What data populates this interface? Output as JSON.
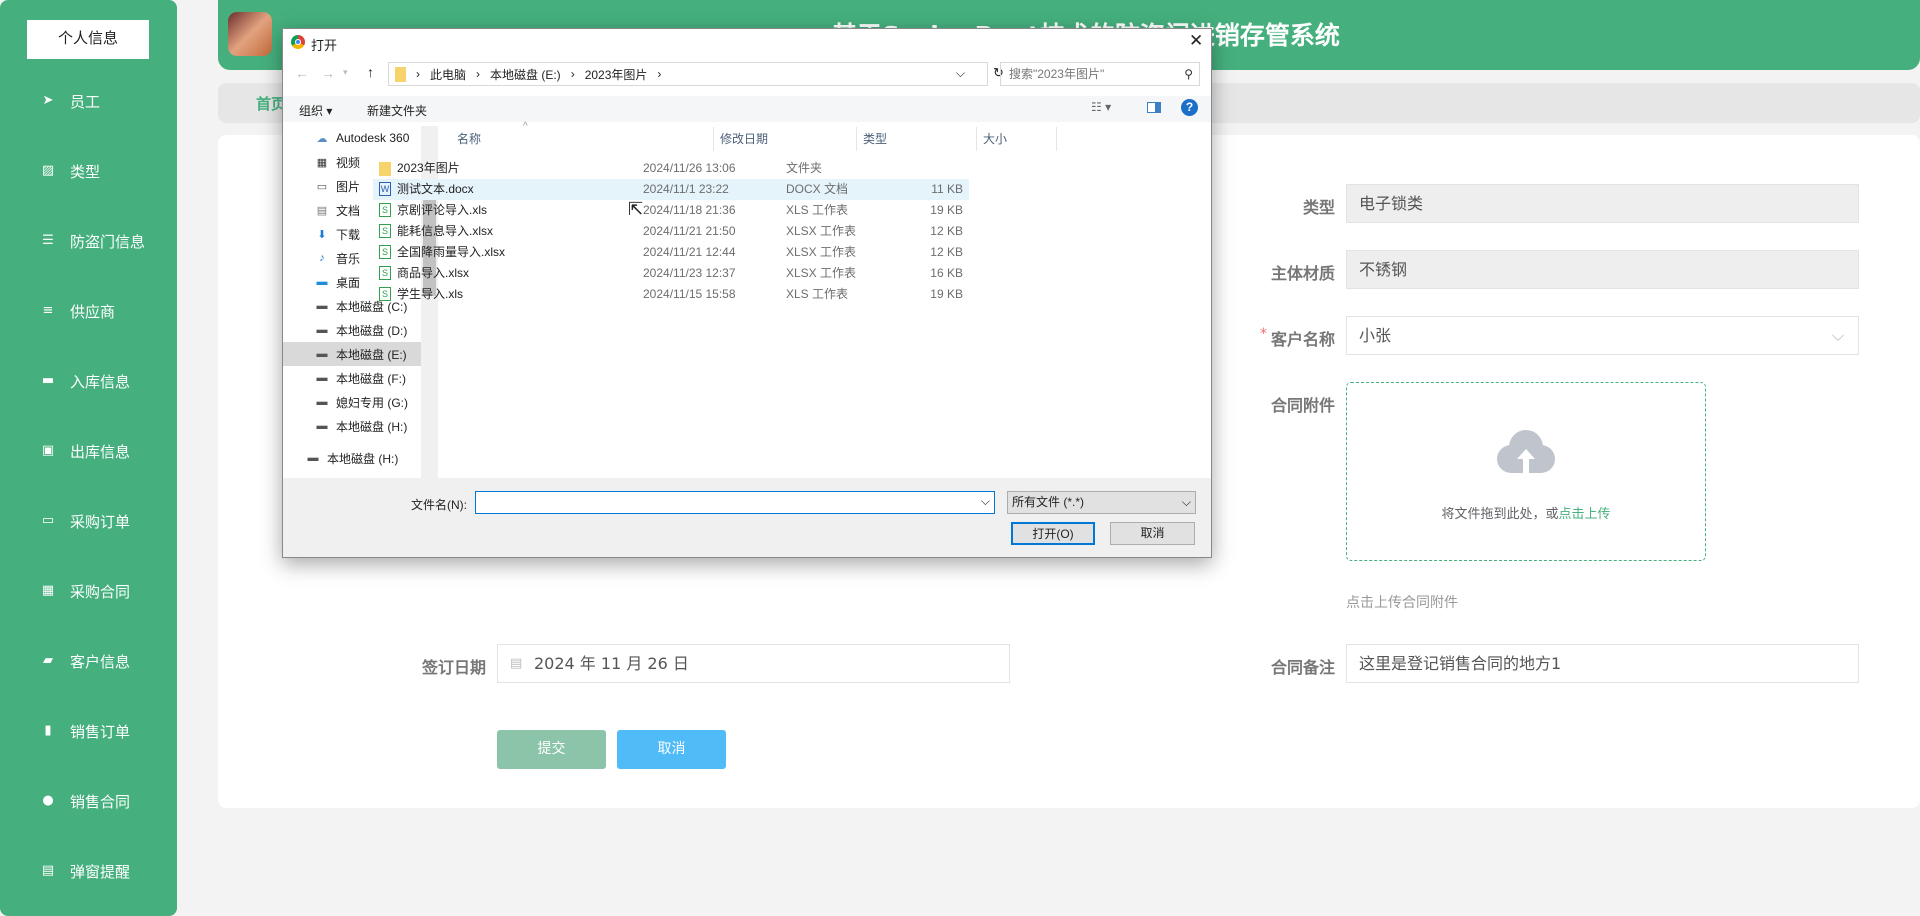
{
  "sidebar": {
    "profile": "个人信息",
    "items": [
      {
        "label": "员工",
        "icon": "paper-plane-icon"
      },
      {
        "label": "类型",
        "icon": "chart-icon"
      },
      {
        "label": "防盗门信息",
        "icon": "sliders-icon"
      },
      {
        "label": "供应商",
        "icon": "list-icon"
      },
      {
        "label": "入库信息",
        "icon": "briefcase-icon"
      },
      {
        "label": "出库信息",
        "icon": "clipboard-x-icon"
      },
      {
        "label": "采购订单",
        "icon": "chat-icon"
      },
      {
        "label": "采购合同",
        "icon": "grid-icon"
      },
      {
        "label": "客户信息",
        "icon": "wallet-icon"
      },
      {
        "label": "销售订单",
        "icon": "bar-chart-icon"
      },
      {
        "label": "销售合同",
        "icon": "bulb-icon"
      },
      {
        "label": "弹窗提醒",
        "icon": "clipboard-icon"
      }
    ]
  },
  "header": {
    "title": "基于SpringBoot技术的防盗门进销存管系统"
  },
  "breadcrumb": {
    "home": "首页"
  },
  "form": {
    "type_label": "类型",
    "type_value": "电子锁类",
    "material_label": "主体材质",
    "material_value": "不锈钢",
    "customer_label": "客户名称",
    "customer_value": "小张",
    "required_mark": "*",
    "attachment_label": "合同附件",
    "upload_text": "将文件拖到此处，或",
    "upload_link": "点击上传",
    "upload_hint": "点击上传合同附件",
    "remark_label": "合同备注",
    "remark_value": "这里是登记销售合同的地方1",
    "date_label": "签订日期",
    "date_value": "2024 年 11 月 26 日",
    "submit": "提交",
    "cancel": "取消"
  },
  "dialog": {
    "title": "打开",
    "path": [
      "此电脑",
      "本地磁盘 (E:)",
      "2023年图片"
    ],
    "search_placeholder": "搜索\"2023年图片\"",
    "organize": "组织 ▾",
    "new_folder": "新建文件夹",
    "nav": [
      "Autodesk 360",
      "视频",
      "图片",
      "文档",
      "下载",
      "音乐",
      "桌面",
      "本地磁盘 (C:)",
      "本地磁盘 (D:)",
      "本地磁盘 (E:)",
      "本地磁盘 (F:)",
      "媳妇专用 (G:)",
      "本地磁盘 (H:)",
      "本地磁盘 (H:)"
    ],
    "columns": [
      "名称",
      "修改日期",
      "类型",
      "大小"
    ],
    "files": [
      {
        "name": "2023年图片",
        "date": "2024/11/26 13:06",
        "type": "文件夹",
        "size": ""
      },
      {
        "name": "测试文本.docx",
        "date": "2024/11/1 23:22",
        "type": "DOCX 文档",
        "size": "11 KB"
      },
      {
        "name": "京剧评论导入.xls",
        "date": "2024/11/18 21:36",
        "type": "XLS 工作表",
        "size": "19 KB"
      },
      {
        "name": "能耗信息导入.xlsx",
        "date": "2024/11/21 21:50",
        "type": "XLSX 工作表",
        "size": "12 KB"
      },
      {
        "name": "全国降雨量导入.xlsx",
        "date": "2024/11/21 12:44",
        "type": "XLSX 工作表",
        "size": "12 KB"
      },
      {
        "name": "商品导入.xlsx",
        "date": "2024/11/23 12:37",
        "type": "XLSX 工作表",
        "size": "16 KB"
      },
      {
        "name": "学生导入.xls",
        "date": "2024/11/15 15:58",
        "type": "XLS 工作表",
        "size": "19 KB"
      }
    ],
    "filename_label": "文件名(N):",
    "filename_value": "",
    "filter": "所有文件 (*.*)",
    "open": "打开(O)",
    "cancel": "取消"
  },
  "colors": {
    "brand": "#45b07e",
    "cancel_btn": "#4fbcf7",
    "submit_btn": "#8cc4aa"
  }
}
